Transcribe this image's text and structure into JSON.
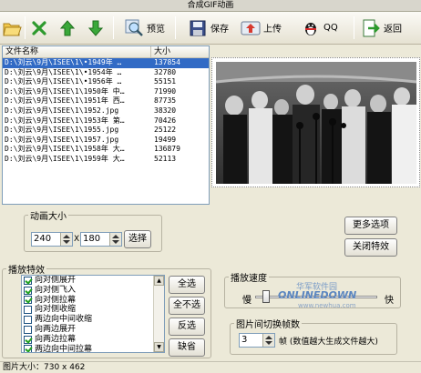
{
  "window": {
    "title": "合成GIF动画"
  },
  "toolbar": {
    "preview_label": "预览",
    "save_label": "保存",
    "upload_label": "上传",
    "qq_label": "QQ",
    "back_label": "返回"
  },
  "file_list": {
    "columns": [
      "文件名称",
      "大小"
    ],
    "rows": [
      {
        "name": "D:\\刘云\\9月\\ISEE\\1\\•1949年 …",
        "size": "137854",
        "selected": true
      },
      {
        "name": "D:\\刘云\\9月\\ISEE\\1\\•1954年 …",
        "size": "32780"
      },
      {
        "name": "D:\\刘云\\9月\\ISEE\\1\\•1956年 …",
        "size": "55151"
      },
      {
        "name": "D:\\刘云\\9月\\ISEE\\1\\1950年 中…",
        "size": "71990"
      },
      {
        "name": "D:\\刘云\\9月\\ISEE\\1\\1951年 西…",
        "size": "87735"
      },
      {
        "name": "D:\\刘云\\9月\\ISEE\\1\\1952.jpg",
        "size": "38320"
      },
      {
        "name": "D:\\刘云\\9月\\ISEE\\1\\1953年 第…",
        "size": "70426"
      },
      {
        "name": "D:\\刘云\\9月\\ISEE\\1\\1955.jpg",
        "size": "25122"
      },
      {
        "name": "D:\\刘云\\9月\\ISEE\\1\\1957.jpg",
        "size": "19499"
      },
      {
        "name": "D:\\刘云\\9月\\ISEE\\1\\1958年 大…",
        "size": "136879"
      },
      {
        "name": "D:\\刘云\\9月\\ISEE\\1\\1959年 大…",
        "size": "52113"
      }
    ]
  },
  "anim_size": {
    "legend": "动画大小",
    "width": "240",
    "separator": "X",
    "height": "180",
    "select_label": "选择"
  },
  "right_buttons": {
    "more_options": "更多选项",
    "close_effects": "关闭特效"
  },
  "effects": {
    "legend": "播放特效",
    "items": [
      {
        "label": "向对侧展开",
        "checked": true
      },
      {
        "label": "向对侧飞入",
        "checked": true
      },
      {
        "label": "向对侧拉幕",
        "checked": true
      },
      {
        "label": "向对侧收缩",
        "checked": false
      },
      {
        "label": "两边向中间收缩",
        "checked": false
      },
      {
        "label": "向两边展开",
        "checked": false
      },
      {
        "label": "向两边拉幕",
        "checked": true
      },
      {
        "label": "两边向中间拉幕",
        "checked": true
      }
    ],
    "select_all": "全选",
    "select_none": "全不选",
    "invert": "反选",
    "default": "缺省"
  },
  "speed": {
    "legend": "播放速度",
    "slow": "慢",
    "fast": "快"
  },
  "frames": {
    "legend": "图片间切换帧数",
    "value": "3",
    "hint": "帧 (数值越大生成文件越大)"
  },
  "status": {
    "text": "图片大小：730 x 462"
  },
  "watermark": {
    "cn": "华军软件园",
    "en": "ONLINEDOWN",
    "url": "www.newhua.com"
  }
}
